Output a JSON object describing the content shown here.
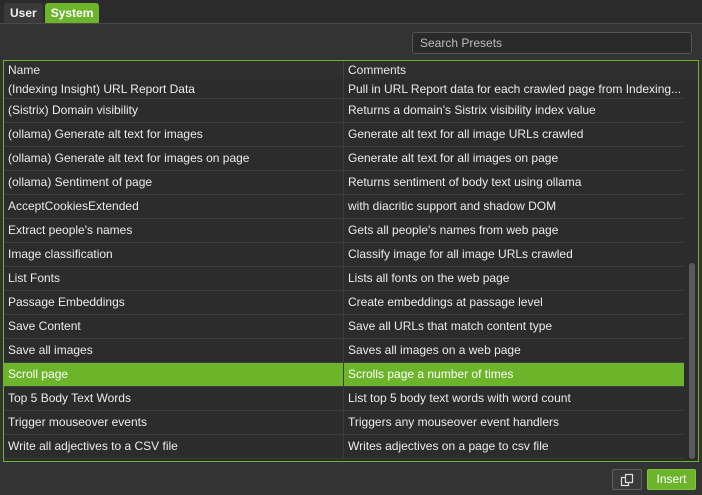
{
  "tabs": [
    {
      "label": "User",
      "active": false
    },
    {
      "label": "System",
      "active": true
    }
  ],
  "search": {
    "placeholder": "Search Presets",
    "value": ""
  },
  "table": {
    "columns": [
      "Name",
      "Comments"
    ],
    "rows": [
      {
        "name": "(Indexing Insight) URL Report Data",
        "comment": "Pull in URL Report data for each crawled page from Indexing..."
      },
      {
        "name": "(Sistrix) Domain visibility",
        "comment": "Returns a domain's Sistrix visibility index value"
      },
      {
        "name": "(ollama) Generate alt text for images",
        "comment": "Generate alt text for all image URLs crawled"
      },
      {
        "name": "(ollama) Generate alt text for images on page",
        "comment": "Generate alt text for all images on page"
      },
      {
        "name": "(ollama) Sentiment of page",
        "comment": "Returns sentiment of body text using ollama"
      },
      {
        "name": "AcceptCookiesExtended",
        "comment": "with diacritic support and shadow DOM"
      },
      {
        "name": "Extract people's names",
        "comment": "Gets all people's names from web page"
      },
      {
        "name": "Image classification",
        "comment": "Classify image for all image URLs crawled"
      },
      {
        "name": "List Fonts",
        "comment": "Lists all fonts on the web page"
      },
      {
        "name": "Passage Embeddings",
        "comment": "Create embeddings at passage level"
      },
      {
        "name": "Save Content",
        "comment": "Save all URLs that match content type"
      },
      {
        "name": "Save all images",
        "comment": "Saves all images on a web page"
      },
      {
        "name": "Scroll page",
        "comment": "Scrolls page a number of times"
      },
      {
        "name": "Top 5 Body Text Words",
        "comment": "List top 5 body text words with word count"
      },
      {
        "name": "Trigger mouseover events",
        "comment": "Triggers any mouseover event handlers"
      },
      {
        "name": "Write all adjectives to a CSV file",
        "comment": "Writes adjectives on a page to csv file"
      }
    ],
    "selected_index": 12
  },
  "footer": {
    "insert_label": "Insert"
  },
  "colors": {
    "accent": "#6cb42a",
    "background": "#333333"
  },
  "icons": {
    "copy": "copy-icon"
  }
}
